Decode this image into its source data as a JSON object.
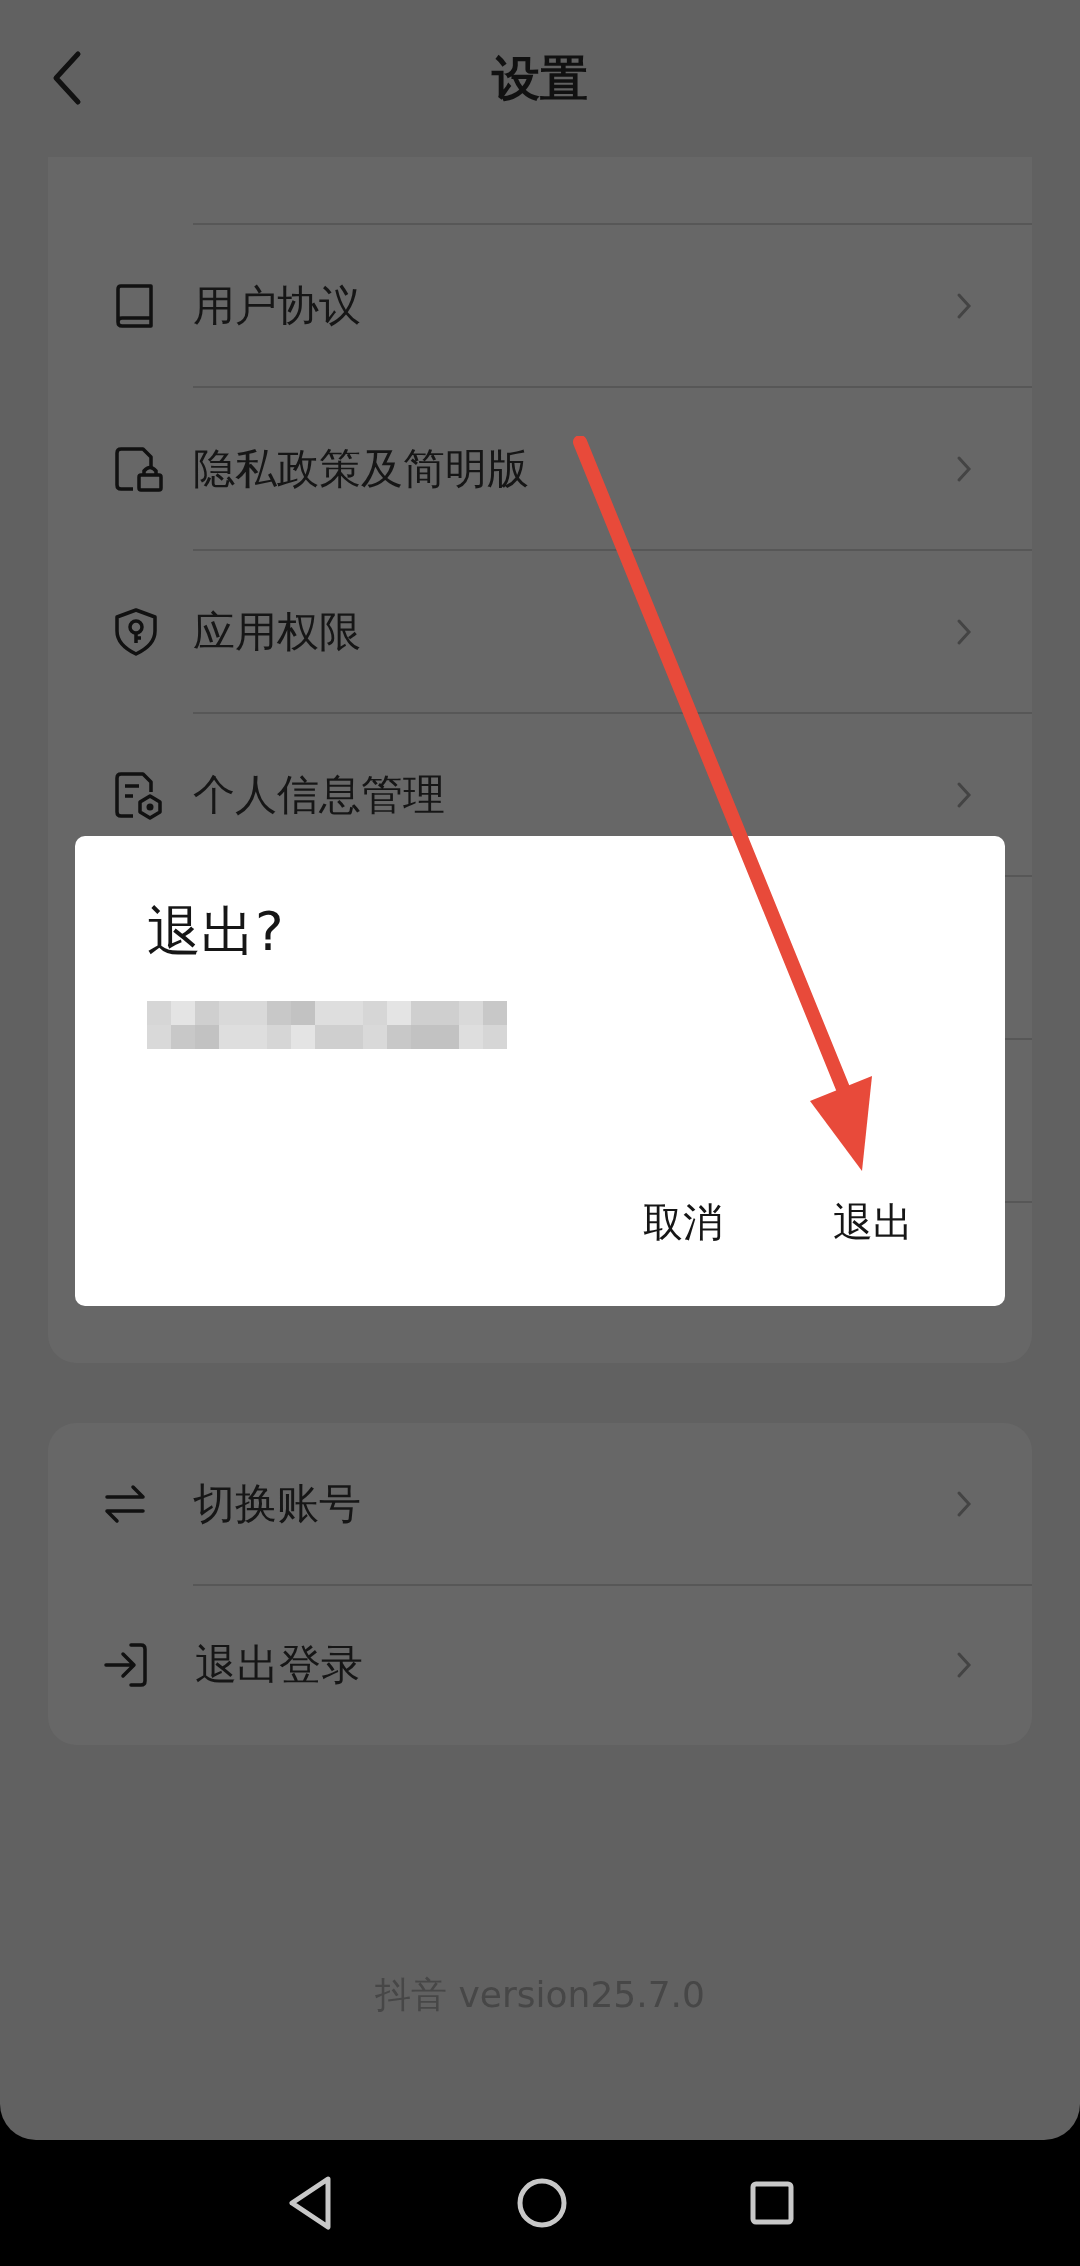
{
  "header": {
    "title": "设置"
  },
  "group_1": {
    "items": [
      {
        "kind": "book",
        "label": "用户协议"
      },
      {
        "kind": "lock-doc",
        "label": "隐私政策及简明版"
      },
      {
        "kind": "shield",
        "label": "应用权限"
      },
      {
        "kind": "gear-doc",
        "label": "个人信息管理"
      }
    ]
  },
  "group_2": {
    "items": [
      {
        "kind": "swap",
        "label": "切换账号"
      },
      {
        "kind": "exit",
        "label": "退出登录"
      }
    ]
  },
  "version": "抖音 version25.7.0",
  "dialog": {
    "title": "退出?",
    "buttons": [
      "取消",
      "退出"
    ]
  },
  "annotation": {
    "kind": "arrow"
  }
}
